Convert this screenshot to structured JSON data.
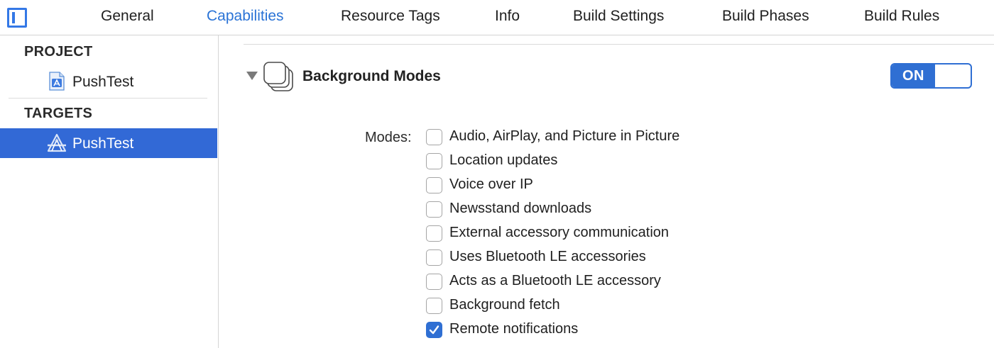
{
  "tabs": [
    {
      "label": "General",
      "active": false
    },
    {
      "label": "Capabilities",
      "active": true
    },
    {
      "label": "Resource Tags",
      "active": false
    },
    {
      "label": "Info",
      "active": false
    },
    {
      "label": "Build Settings",
      "active": false
    },
    {
      "label": "Build Phases",
      "active": false
    },
    {
      "label": "Build Rules",
      "active": false
    }
  ],
  "sidebar": {
    "project_title": "PROJECT",
    "project_item": "PushTest",
    "targets_title": "TARGETS",
    "target_item": "PushTest",
    "selected": "target"
  },
  "capability": {
    "title": "Background Modes",
    "toggle_label": "ON",
    "modes_label": "Modes:",
    "modes": [
      {
        "label": "Audio, AirPlay, and Picture in Picture",
        "checked": false
      },
      {
        "label": "Location updates",
        "checked": false
      },
      {
        "label": "Voice over IP",
        "checked": false
      },
      {
        "label": "Newsstand downloads",
        "checked": false
      },
      {
        "label": "External accessory communication",
        "checked": false
      },
      {
        "label": "Uses Bluetooth LE accessories",
        "checked": false
      },
      {
        "label": "Acts as a Bluetooth LE accessory",
        "checked": false
      },
      {
        "label": "Background fetch",
        "checked": false
      },
      {
        "label": "Remote notifications",
        "checked": true
      }
    ]
  },
  "colors": {
    "accent": "#2f6fd3",
    "selection": "#3269d6",
    "active_tab": "#2a73d6"
  },
  "icons": {
    "sidebar_toggle": "sidebar-toggle-icon",
    "project": "xcode-project-icon",
    "target": "app-target-icon",
    "capability": "background-modes-icon",
    "disclosure": "disclosure-triangle-icon",
    "check": "checkmark-icon"
  }
}
